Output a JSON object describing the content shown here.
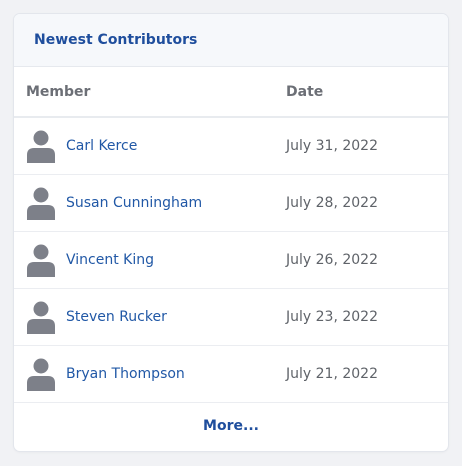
{
  "widget": {
    "title": "Newest Contributors",
    "columns": {
      "member": "Member",
      "date": "Date"
    },
    "rows": [
      {
        "name": "Carl Kerce",
        "date": "July 31, 2022",
        "avatar_icon": "user-avatar-icon"
      },
      {
        "name": "Susan Cunningham",
        "date": "July 28, 2022",
        "avatar_icon": "user-avatar-icon"
      },
      {
        "name": "Vincent King",
        "date": "July 26, 2022",
        "avatar_icon": "user-avatar-icon"
      },
      {
        "name": "Steven Rucker",
        "date": "July 23, 2022",
        "avatar_icon": "user-avatar-icon"
      },
      {
        "name": "Bryan Thompson",
        "date": "July 21, 2022",
        "avatar_icon": "user-avatar-icon"
      }
    ],
    "more_label": "More..."
  },
  "colors": {
    "accent": "#1f4e9d",
    "link": "#2158a6",
    "avatar": "#7d8089",
    "background": "#f1f2f5"
  }
}
